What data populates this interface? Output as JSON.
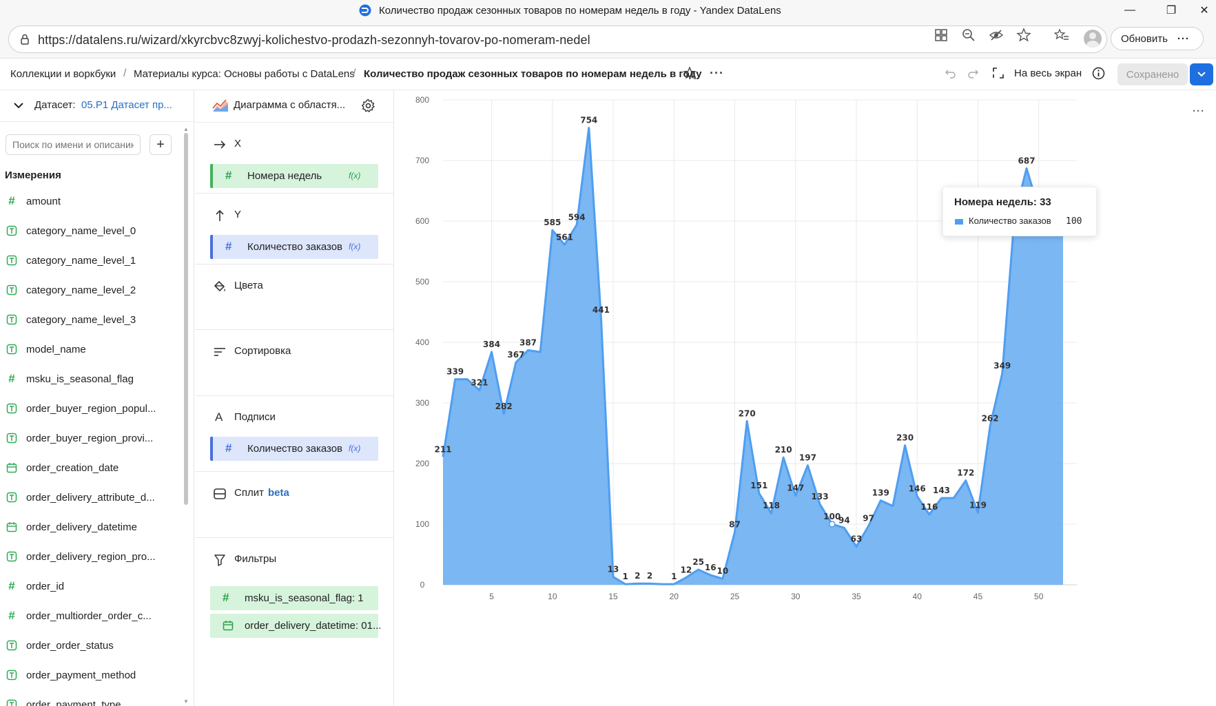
{
  "window": {
    "title": "Количество продаж сезонных товаров по номерам недель в году - Yandex DataLens"
  },
  "address_bar": {
    "url": "https://datalens.ru/wizard/xkyrcbvc8zwyj-kolichestvo-prodazh-sezonnyh-tovarov-po-nomeram-nedel",
    "refresh_label": "Обновить",
    "more_label": "···"
  },
  "breadcrumbs": {
    "items": [
      "Коллекции и воркбуки",
      "Материалы курса: Основы работы с DataLens",
      "Количество продаж сезонных товаров по номерам недель в году"
    ],
    "separator": "/"
  },
  "toolbar": {
    "more_label": "···",
    "fullscreen_label": "На весь экран",
    "saved_label": "Сохранено"
  },
  "dataset": {
    "label": "Датасет:",
    "value": "05.P1 Датасет пр...",
    "search_placeholder": "Поиск по имени и описанию",
    "add_label": "+",
    "section_title": "Измерения",
    "fields": [
      {
        "name": "amount",
        "type": "number"
      },
      {
        "name": "category_name_level_0",
        "type": "text"
      },
      {
        "name": "category_name_level_1",
        "type": "text"
      },
      {
        "name": "category_name_level_2",
        "type": "text"
      },
      {
        "name": "category_name_level_3",
        "type": "text"
      },
      {
        "name": "model_name",
        "type": "text"
      },
      {
        "name": "msku_is_seasonal_flag",
        "type": "number"
      },
      {
        "name": "order_buyer_region_popul...",
        "type": "text"
      },
      {
        "name": "order_buyer_region_provi...",
        "type": "text"
      },
      {
        "name": "order_creation_date",
        "type": "date"
      },
      {
        "name": "order_delivery_attribute_d...",
        "type": "text"
      },
      {
        "name": "order_delivery_datetime",
        "type": "date"
      },
      {
        "name": "order_delivery_region_pro...",
        "type": "text"
      },
      {
        "name": "order_id",
        "type": "number"
      },
      {
        "name": "order_multiorder_order_c...",
        "type": "number"
      },
      {
        "name": "order_order_status",
        "type": "text"
      },
      {
        "name": "order_payment_method",
        "type": "text"
      },
      {
        "name": "order_payment_type",
        "type": "text"
      }
    ]
  },
  "visualization": {
    "name": "Диаграмма с областя...",
    "sections": {
      "x": {
        "title": "X",
        "fields": [
          {
            "label": "Номера недель",
            "fx": "f(x)"
          }
        ]
      },
      "y": {
        "title": "Y",
        "fields": [
          {
            "label": "Количество заказов",
            "fx": "f(x)"
          }
        ]
      },
      "colors": {
        "title": "Цвета"
      },
      "sort": {
        "title": "Сортировка"
      },
      "labels": {
        "title": "Подписи",
        "fields": [
          {
            "label": "Количество заказов",
            "fx": "f(x)"
          }
        ]
      },
      "split": {
        "title": "Сплит",
        "badge": "beta"
      },
      "filters": {
        "title": "Фильтры",
        "fields": [
          {
            "label": "msku_is_seasonal_flag: 1"
          },
          {
            "label": "order_delivery_datetime: 01..."
          }
        ]
      }
    }
  },
  "tooltip": {
    "title": "Номера недель: 33",
    "series": "Количество заказов",
    "value": "100"
  },
  "chart_more_label": "···",
  "colors": {
    "area_fill": "#73b3f2",
    "area_line": "#4f9ef0",
    "accent": "#1f6fe0",
    "dimension_green": "#2faa54"
  },
  "chart_data": {
    "type": "area",
    "x": [
      1,
      2,
      3,
      4,
      5,
      6,
      7,
      8,
      9,
      10,
      11,
      12,
      13,
      14,
      15,
      16,
      17,
      18,
      19,
      20,
      21,
      22,
      23,
      24,
      25,
      26,
      27,
      28,
      29,
      30,
      31,
      32,
      33,
      34,
      35,
      36,
      37,
      38,
      39,
      40,
      41,
      42,
      43,
      44,
      45,
      46,
      47,
      48,
      49,
      50,
      51,
      52
    ],
    "series": [
      {
        "name": "Количество заказов",
        "values": [
          211,
          339,
          339,
          321,
          384,
          282,
          367,
          387,
          384,
          585,
          561,
          594,
          754,
          441,
          13,
          1,
          2,
          2,
          1,
          1,
          12,
          25,
          16,
          10,
          87,
          270,
          151,
          118,
          210,
          147,
          197,
          133,
          100,
          94,
          63,
          97,
          139,
          130,
          230,
          146,
          116,
          143,
          143,
          172,
          119,
          262,
          349,
          607,
          687,
          620,
          585,
          631
        ]
      }
    ],
    "labeled_points": {
      "x": [
        1,
        2,
        4,
        5,
        6,
        7,
        8,
        10,
        11,
        12,
        13,
        14,
        15,
        16,
        17,
        18,
        20,
        21,
        22,
        23,
        24,
        25,
        26,
        27,
        28,
        29,
        30,
        31,
        32,
        33,
        34,
        35,
        36,
        37,
        39,
        40,
        41,
        42,
        44,
        45,
        46,
        47,
        48,
        49,
        50,
        51,
        52
      ],
      "values": [
        211,
        339,
        321,
        384,
        282,
        367,
        387,
        585,
        561,
        594,
        754,
        441,
        13,
        1,
        2,
        2,
        1,
        12,
        25,
        16,
        10,
        87,
        270,
        151,
        118,
        210,
        147,
        197,
        133,
        100,
        94,
        63,
        97,
        139,
        230,
        146,
        116,
        143,
        172,
        119,
        262,
        349,
        607,
        687,
        620,
        585,
        631
      ]
    },
    "x_ticks": [
      5,
      10,
      15,
      20,
      25,
      30,
      35,
      40,
      45,
      50
    ],
    "y_ticks": [
      0,
      100,
      200,
      300,
      400,
      500,
      600,
      700,
      800
    ],
    "ylim": [
      0,
      800
    ],
    "xlim": [
      1,
      52
    ],
    "highlighted_x": 33,
    "grid": true,
    "legend": "none"
  }
}
